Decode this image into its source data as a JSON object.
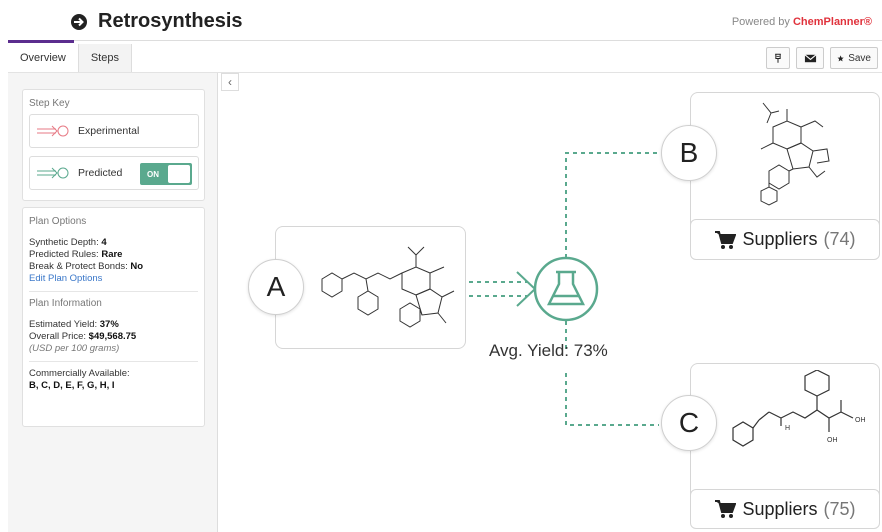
{
  "header": {
    "title": "Retrosynthesis",
    "powered_by_prefix": "Powered by ",
    "powered_by_brand": "ChemPlanner®"
  },
  "tabs": [
    {
      "label": "Overview",
      "active": true
    },
    {
      "label": "Steps",
      "active": false
    }
  ],
  "toolbar": {
    "save_label": "Save",
    "icons": [
      "pin-icon",
      "mail-icon",
      "star-icon"
    ]
  },
  "step_key": {
    "title": "Step Key",
    "experimental_label": "Experimental",
    "predicted_label": "Predicted",
    "toggle_label": "ON",
    "toggle_state": true
  },
  "plan_options": {
    "title": "Plan Options",
    "synthetic_depth_label": "Synthetic Depth:",
    "synthetic_depth_value": "4",
    "predicted_rules_label": "Predicted Rules:",
    "predicted_rules_value": "Rare",
    "break_protect_label": "Break & Protect Bonds:",
    "break_protect_value": "No",
    "edit_link": "Edit Plan Options"
  },
  "plan_information": {
    "title": "Plan Information",
    "yield_label": "Estimated Yield:",
    "yield_value": "37%",
    "price_label": "Overall Price:",
    "price_value": "$49,568.75",
    "price_note": "(USD per 100 grams)",
    "commercial_label": "Commercially Available:",
    "commercial_value": "B, C, D, E, F, G, H, I"
  },
  "collapse_label": "‹",
  "diagram": {
    "node_a": "A",
    "node_b": "B",
    "node_c": "C",
    "avg_yield": "Avg. Yield: 73%",
    "suppliers_b_label": "Suppliers",
    "suppliers_b_count": "(74)",
    "suppliers_c_label": "Suppliers",
    "suppliers_c_count": "(75)",
    "accent_color": "#5aa98e",
    "predicted_color": "#5aa98e",
    "experimental_color": "#e77a85"
  }
}
